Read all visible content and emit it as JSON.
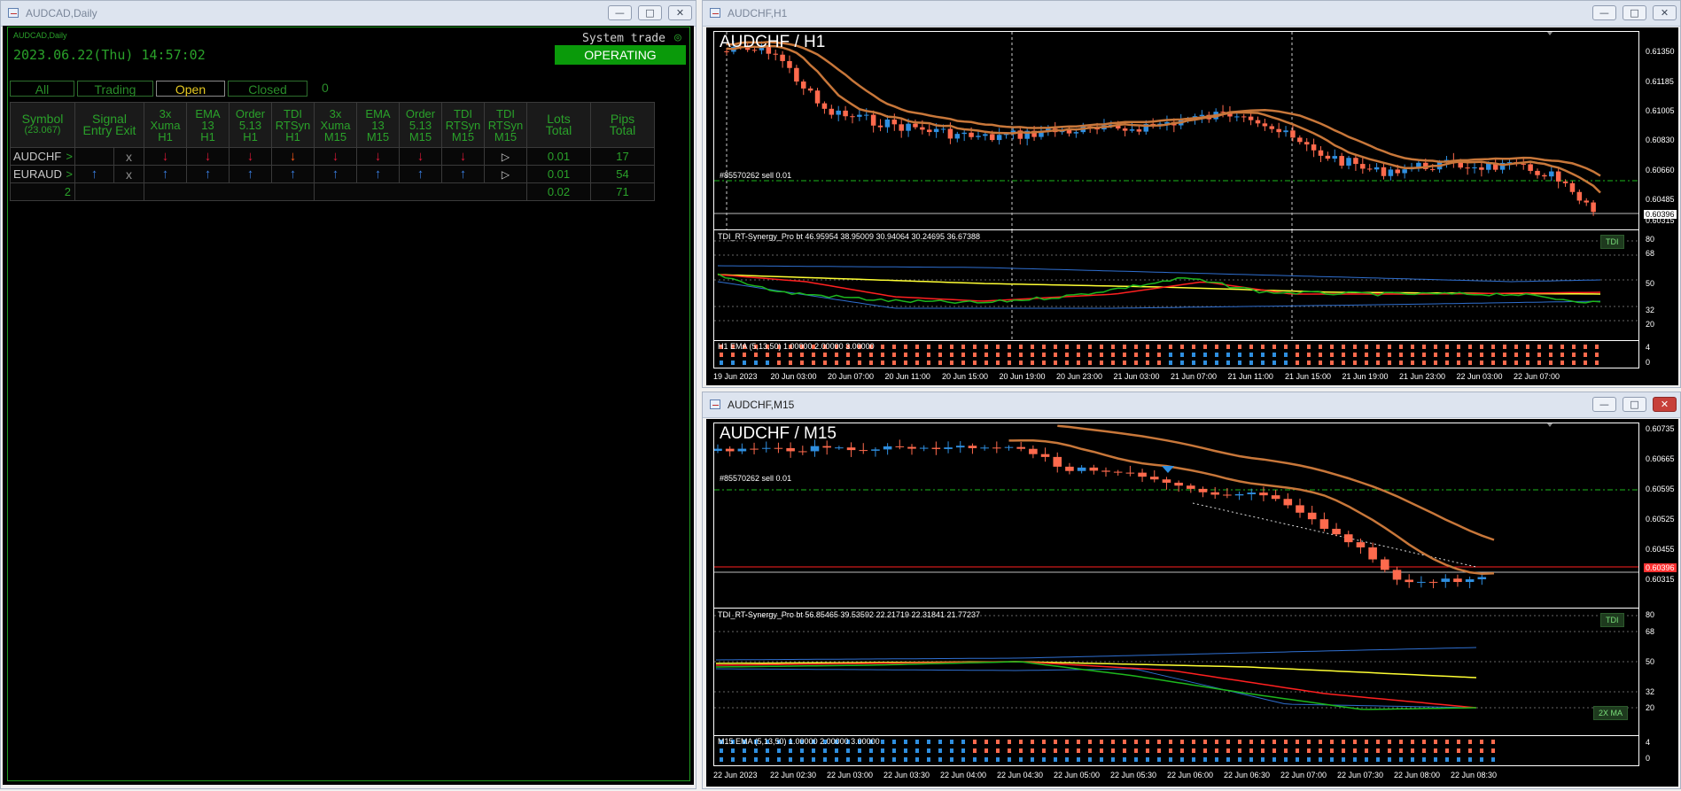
{
  "left_window": {
    "title": "AUDCAD,Daily",
    "chart_label": "AUDCAD,Daily",
    "datetime": "2023.06.22(Thu) 14:57:02",
    "system_trade_label": "System trade",
    "status": "OPERATING",
    "tabs": [
      "All",
      "Trading",
      "Open",
      "Closed"
    ],
    "tab_count": "0",
    "table": {
      "headers": {
        "symbol": "Symbol",
        "symbol_sub": "(23.067)",
        "signal": "Signal",
        "entry": "Entry",
        "exit": "Exit",
        "h1_cols": [
          [
            "3x",
            "Xuma",
            "H1"
          ],
          [
            "EMA",
            "13",
            "H1"
          ],
          [
            "Order",
            "5.13",
            "H1"
          ],
          [
            "TDI",
            "RTSyn",
            "H1"
          ]
        ],
        "m15_cols": [
          [
            "3x",
            "Xuma",
            "M15"
          ],
          [
            "EMA",
            "13",
            "M15"
          ],
          [
            "Order",
            "5.13",
            "M15"
          ],
          [
            "TDI",
            "RTSyn",
            "M15"
          ],
          [
            "TDI",
            "RTSyn",
            "M15"
          ]
        ],
        "lots": [
          "Lots",
          "Total"
        ],
        "pips": [
          "Pips",
          "Total"
        ]
      },
      "rows": [
        {
          "symbol": "AUDCHF",
          "exit": "x",
          "lots": "0.01",
          "pips": "17"
        },
        {
          "symbol": "EURAUD",
          "exit": "x",
          "lots": "0.01",
          "pips": "54"
        }
      ],
      "total": {
        "count": "2",
        "lots": "0.02",
        "pips": "71"
      }
    }
  },
  "h1_window": {
    "title": "AUDCHF,H1",
    "symbol_label": "AUDCHF / H1",
    "order_label": "#85570262 sell 0.01",
    "tdi_label": "TDI_RT-Synergy_Pro bt 46.95954 38.95009 30.94064 30.24695 36.67388",
    "tdi_badge": "TDI",
    "ema_label": "H1 EMA (5,13,50) 1.00000 2.00000 3.00000",
    "price_axis": [
      "0.61350",
      "0.61185",
      "0.61005",
      "0.60830",
      "0.60660",
      "0.60485",
      "0.60396",
      "0.60315"
    ],
    "current_price": "0.60396",
    "tdi_axis": [
      "80",
      "68",
      "50",
      "32",
      "20"
    ],
    "ema_axis": [
      "4",
      "0"
    ],
    "time_axis": [
      "19 Jun 2023",
      "20 Jun 03:00",
      "20 Jun 07:00",
      "20 Jun 11:00",
      "20 Jun 15:00",
      "20 Jun 19:00",
      "20 Jun 23:00",
      "21 Jun 03:00",
      "21 Jun 07:00",
      "21 Jun 11:00",
      "21 Jun 15:00",
      "21 Jun 19:00",
      "21 Jun 23:00",
      "22 Jun 03:00",
      "22 Jun 07:00"
    ]
  },
  "m15_window": {
    "title": "AUDCHF,M15",
    "symbol_label": "AUDCHF / M15",
    "order_label": "#85570262 sell 0.01",
    "tdi_label": "TDI_RT-Synergy_Pro bt 56.85465 39.53592 22.21719 22.31841 21.77237",
    "tdi_badge": "TDI",
    "ma_badge": "2X MA",
    "ema_label": "M15 EMA (5,13,50) 1.00000 2.00000 3.00000",
    "price_axis": [
      "0.60735",
      "0.60665",
      "0.60595",
      "0.60525",
      "0.60455",
      "0.60396",
      "0.60315"
    ],
    "current_price": "0.60396",
    "tdi_axis": [
      "80",
      "68",
      "50",
      "32",
      "20"
    ],
    "ema_axis": [
      "4",
      "0"
    ],
    "time_axis": [
      "22 Jun 2023",
      "22 Jun 02:30",
      "22 Jun 03:00",
      "22 Jun 03:30",
      "22 Jun 04:00",
      "22 Jun 04:30",
      "22 Jun 05:00",
      "22 Jun 05:30",
      "22 Jun 06:00",
      "22 Jun 06:30",
      "22 Jun 07:00",
      "22 Jun 07:30",
      "22 Jun 08:00",
      "22 Jun 08:30"
    ]
  },
  "colors": {
    "bull": "#2f8fe0",
    "bear": "#ff6a4d",
    "ema": "#c8773a",
    "green": "#1db81d",
    "yellow": "#ffff33",
    "red": "#ff2020",
    "blue": "#2f6fd0"
  }
}
